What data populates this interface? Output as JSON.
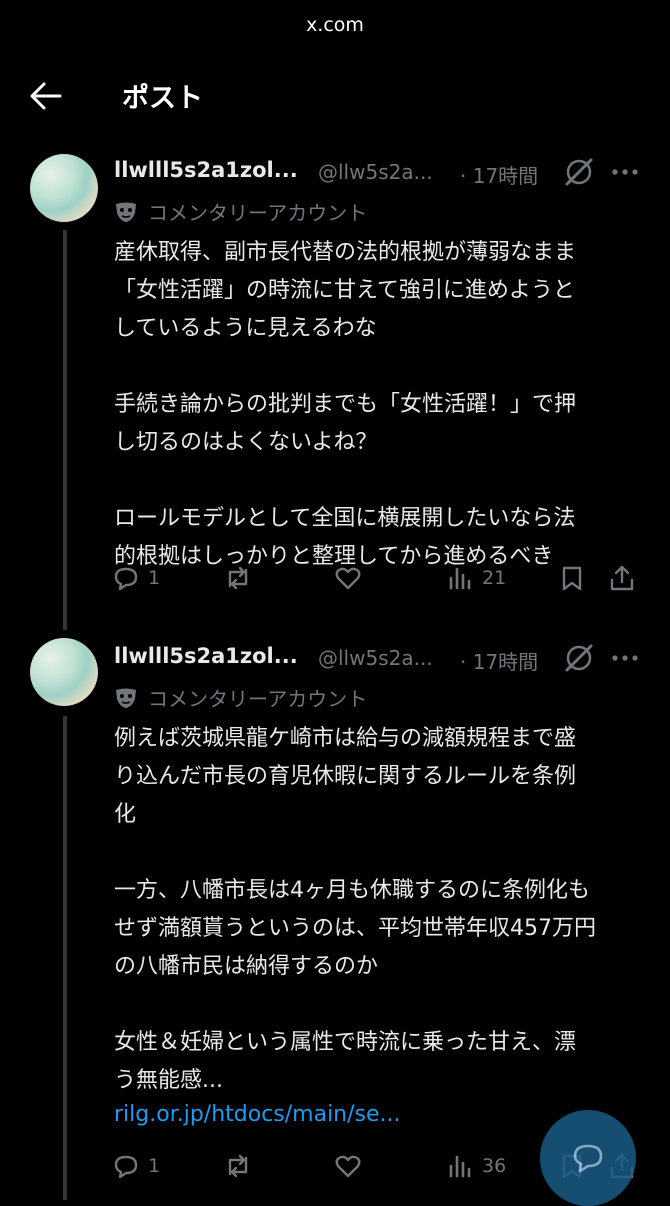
{
  "url": "x.com",
  "header": {
    "title": "ポスト"
  },
  "posts": [
    {
      "display_name": "llwlll5s2a1zol...",
      "handle": "@llw5s2a...",
      "time": "· 17時間",
      "badge": "コメンタリーアカウント",
      "body": "産休取得、副市長代替の法的根拠が薄弱なまま\n「女性活躍」の時流に甘えて強引に進めようと\nしているように見えるわな\n\n手続き論からの批判までも「女性活躍！」で押\nし切るのはよくないよね？\n\nロールモデルとして全国に横展開したいなら法\n的根拠はしっかりと整理してから進めるべき",
      "link": "",
      "replies": "1",
      "reposts": "",
      "likes": "",
      "views": "21"
    },
    {
      "display_name": "llwlll5s2a1zol...",
      "handle": "@llw5s2a...",
      "time": "· 17時間",
      "badge": "コメンタリーアカウント",
      "body": "例えば茨城県龍ケ崎市は給与の減額規程まで盛\nり込んだ市長の育児休暇に関するルールを条例\n化\n\n一方、八幡市長は4ヶ月も休職するのに条例化も\nせず満額貰うというのは、平均世帯年収457万円\nの八幡市民は納得するのか\n\n女性＆妊婦という属性で時流に乗った甘え、漂\nう無能感...",
      "link": "rilg.or.jp/htdocs/main/se...",
      "replies": "1",
      "reposts": "",
      "likes": "",
      "views": "36"
    }
  ],
  "icons": [
    "back-arrow-icon",
    "grok-icon",
    "more-icon",
    "mask-icon",
    "reply-icon",
    "repost-icon",
    "like-icon",
    "views-icon",
    "bookmark-icon",
    "share-icon",
    "compose-icon"
  ],
  "colors": {
    "background": "#000000",
    "text": "#e7e9ea",
    "muted": "#71767b",
    "link": "#1d9bf0",
    "fab": "#1a5c86"
  }
}
